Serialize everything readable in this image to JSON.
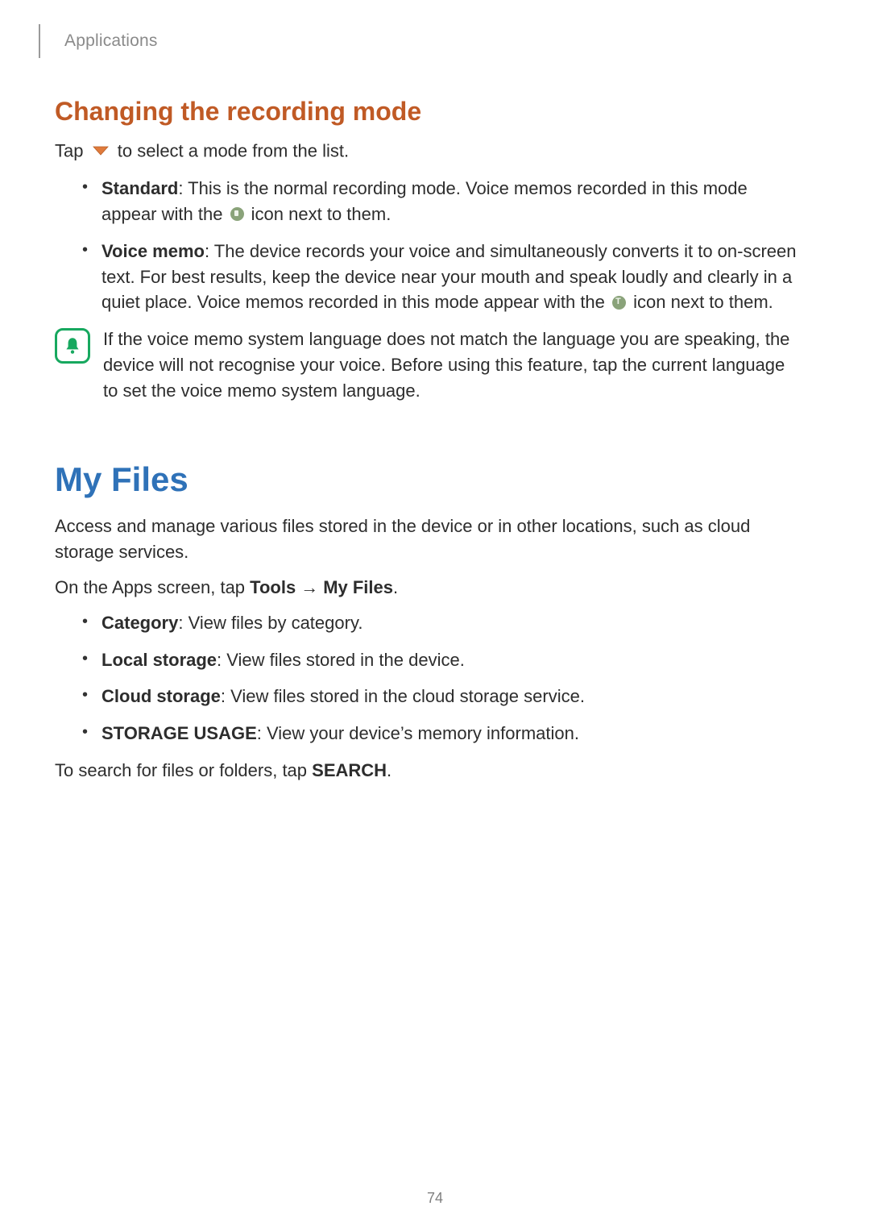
{
  "header": {
    "breadcrumb": "Applications"
  },
  "section1": {
    "title": "Changing the recording mode",
    "intro_pre": "Tap",
    "intro_post": "to select a mode from the list.",
    "bullets": {
      "standard": {
        "term": "Standard",
        "desc1": ": This is the normal recording mode. Voice memos recorded in this mode appear with the ",
        "desc2": " icon next to them."
      },
      "voicememo": {
        "term": "Voice memo",
        "desc1": ": The device records your voice and simultaneously converts it to on-screen text. For best results, keep the device near your mouth and speak loudly and clearly in a quiet place. Voice memos recorded in this mode appear with the ",
        "desc2": " icon next to them."
      }
    },
    "note": "If the voice memo system language does not match the language you are speaking, the device will not recognise your voice. Before using this feature, tap the current language to set the voice memo system language."
  },
  "section2": {
    "title": "My Files",
    "para1": "Access and manage various files stored in the device or in other locations, such as cloud storage services.",
    "para2_pre": "On the Apps screen, tap ",
    "para2_tools": "Tools",
    "para2_arrow": "→",
    "para2_myfiles": "My Files",
    "para2_post": ".",
    "bullets": {
      "category": {
        "term": "Category",
        "desc": ": View files by category."
      },
      "local": {
        "term": "Local storage",
        "desc": ": View files stored in the device."
      },
      "cloud": {
        "term": "Cloud storage",
        "desc": ": View files stored in the cloud storage service."
      },
      "usage": {
        "term": "STORAGE USAGE",
        "desc": ": View your device’s memory information."
      }
    },
    "search_pre": "To search for files or folders, tap ",
    "search_term": "SEARCH",
    "search_post": "."
  },
  "page_number": "74"
}
